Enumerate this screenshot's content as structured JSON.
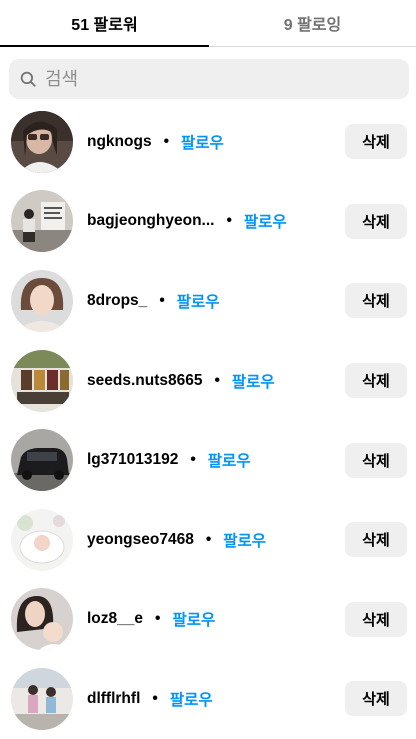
{
  "tabs": {
    "followers": "51 팔로워",
    "following": "9 팔로잉"
  },
  "search": {
    "placeholder": "검색"
  },
  "follow_label": "팔로우",
  "remove_label": "삭제",
  "followers": [
    {
      "username": "ngknogs",
      "avatar": "woman-sunglasses"
    },
    {
      "username": "bagjeonghyeon...",
      "avatar": "person-sitting-poster"
    },
    {
      "username": "8drops_",
      "avatar": "woman-portrait"
    },
    {
      "username": "seeds.nuts8665",
      "avatar": "nut-packages"
    },
    {
      "username": "lg371013192",
      "avatar": "black-car"
    },
    {
      "username": "yeongseo7468",
      "avatar": "baby-white-blanket"
    },
    {
      "username": "loz8__e",
      "avatar": "woman-with-baby"
    },
    {
      "username": "dlfflrhfl",
      "avatar": "two-people-outdoor"
    }
  ]
}
